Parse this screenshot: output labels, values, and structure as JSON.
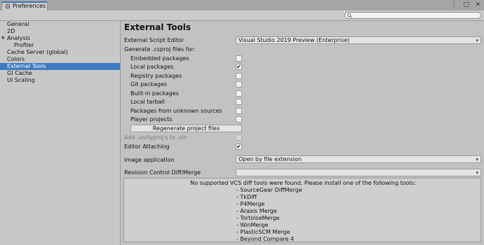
{
  "window": {
    "tab_title": "Preferences",
    "controls": [
      "⋮",
      "□",
      "✕"
    ]
  },
  "search": {
    "placeholder": ""
  },
  "sidebar": {
    "items": [
      {
        "label": "General"
      },
      {
        "label": "2D"
      },
      {
        "label": "Analysis",
        "expanded": true
      },
      {
        "label": "Profiler"
      },
      {
        "label": "Cache Server (global)"
      },
      {
        "label": "Colors"
      },
      {
        "label": "External Tools",
        "selected": true
      },
      {
        "label": "GI Cache"
      },
      {
        "label": "UI Scaling"
      }
    ]
  },
  "main": {
    "heading": "External Tools",
    "script_editor": {
      "label": "External Script Editor",
      "value": "Visual Studio 2019 Preview (Enterprise)"
    },
    "generate_label": "Generate .csproj files for:",
    "options": [
      {
        "label": "Embedded packages",
        "checked": false
      },
      {
        "label": "Local packages",
        "checked": true
      },
      {
        "label": "Registry packages",
        "checked": false
      },
      {
        "label": "Git packages",
        "checked": false
      },
      {
        "label": "Built-in packages",
        "checked": false
      },
      {
        "label": "Local tarball",
        "checked": false
      },
      {
        "label": "Packages from unknown sources",
        "checked": false
      },
      {
        "label": "Player projects",
        "checked": false
      }
    ],
    "regenerate_label": "Regenerate project files",
    "add_unityproj": {
      "label": "Add .unityproj's to .sln",
      "checked": false,
      "disabled": true
    },
    "editor_attaching": {
      "label": "Editor Attaching",
      "checked": true
    },
    "image_application": {
      "label": "Image application",
      "value": "Open by file extension"
    },
    "revision_control": {
      "label": "Revision Control Diff/Merge",
      "value": ""
    },
    "vcs_message": "No supported VCS diff tools were found. Please install one of the following tools:",
    "vcs_tools": [
      "- SourceGear DiffMerge",
      "- TkDiff",
      "- P4Merge",
      "- Araxis Merge",
      "- TortoiseMerge",
      "- WinMerge",
      "- PlasticSCM Merge",
      "- Beyond Compare 4"
    ],
    "checkmark": "✔",
    "dropdown_arrow": "▾"
  },
  "colors": {
    "accent": "#3d7bc2",
    "background": "#c2c2c2"
  }
}
